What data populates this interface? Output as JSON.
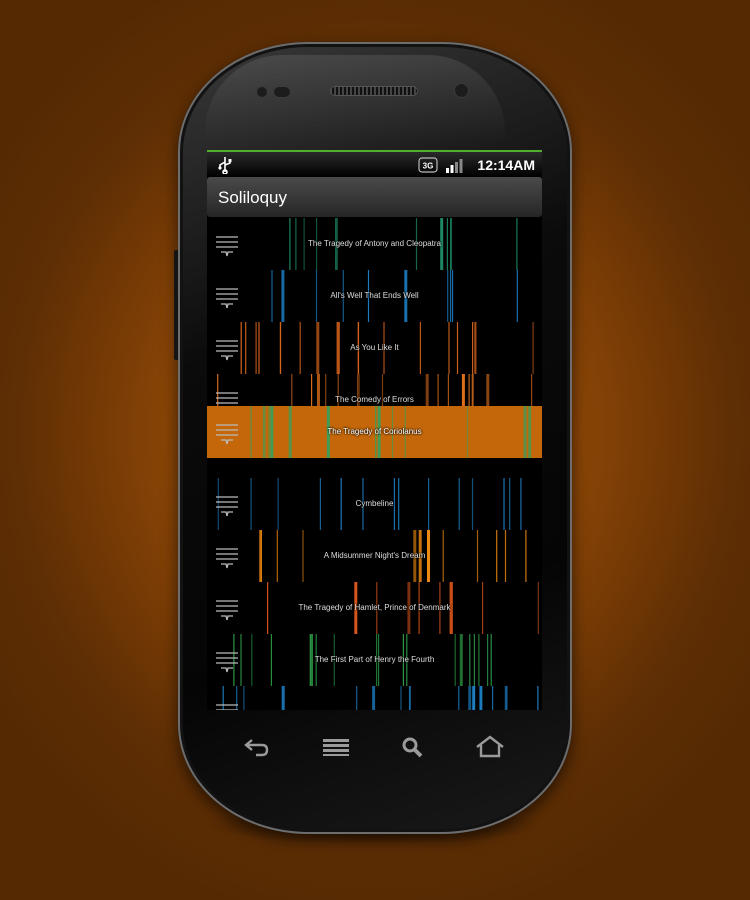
{
  "status_bar": {
    "usb": "usb-icon",
    "network": "3G",
    "signal": "signal-icon",
    "time": "12:14AM"
  },
  "app": {
    "title": "Soliloquy"
  },
  "colors": {
    "accent": "#4eb02e",
    "selected": "#c4670a",
    "teal": "#1f8f6a",
    "blue": "#1e7fc4",
    "orange": "#d9651c",
    "green": "#3aa03a"
  },
  "plays": [
    {
      "title": "The Tragedy of Antony and Cleopatra",
      "color": "#1f8f6a"
    },
    {
      "title": "All's Well That Ends Well",
      "color": "#1e7fc4"
    },
    {
      "title": "As You Like It",
      "color": "#d9651c"
    },
    {
      "title": "The Comedy of Errors",
      "color": "#e0701c"
    },
    {
      "title": "The Tragedy of Coriolanus",
      "color": "#3aa05a",
      "selected": true
    },
    {
      "title": "Cymbeline",
      "color": "#1e7fc4"
    },
    {
      "title": "A Midsummer Night's Dream",
      "color": "#f08a10"
    },
    {
      "title": "The Tragedy of Hamlet, Prince of Denmark",
      "color": "#e0581c"
    },
    {
      "title": "The First Part of Henry the Fourth",
      "color": "#2ea04a"
    },
    {
      "title": "",
      "color": "#1e7fc4"
    }
  ],
  "nav_buttons": [
    "back-icon",
    "menu-icon",
    "search-icon",
    "home-icon"
  ]
}
